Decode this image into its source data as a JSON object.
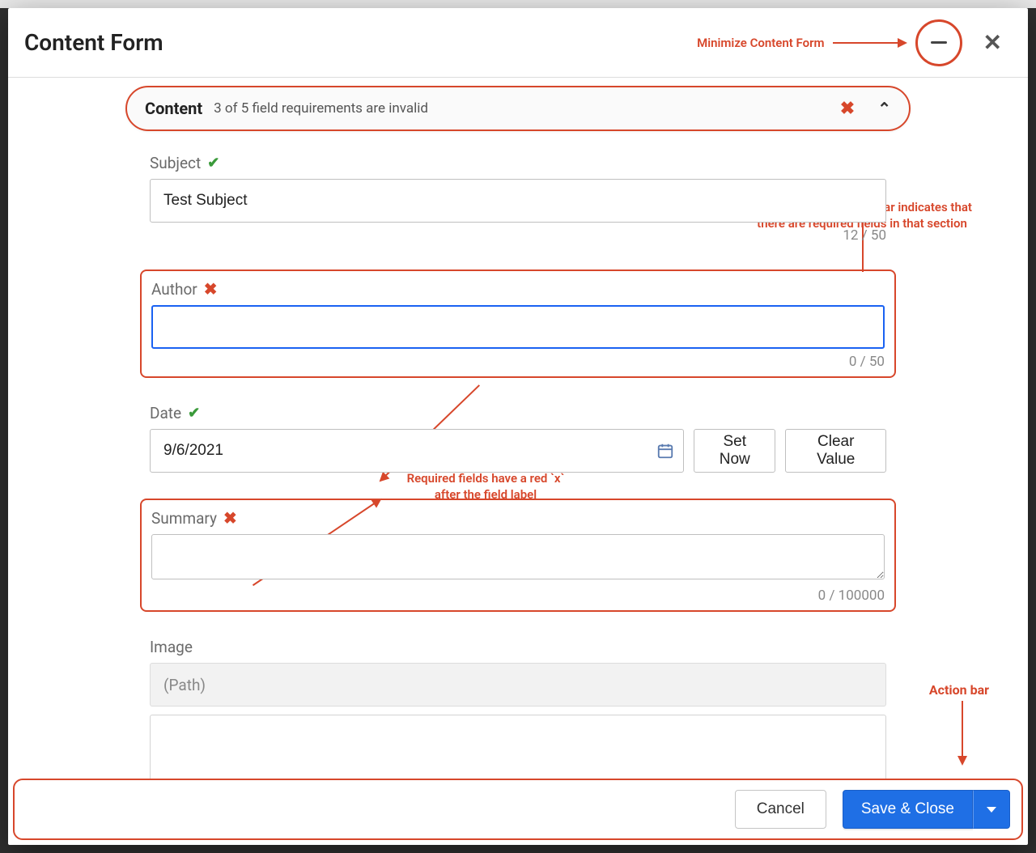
{
  "modal": {
    "title": "Content Form",
    "minimize_annotation": "Minimize Content Form",
    "minimize_icon": "minimize-icon",
    "close_icon": "close-icon"
  },
  "section": {
    "title": "Content",
    "status": "3 of 5 field requirements are invalid",
    "has_error": true,
    "annotation": "A red `x` in the section bar indicates that there are required fields in that section"
  },
  "fields": {
    "subject": {
      "label": "Subject",
      "valid": true,
      "value": "Test Subject",
      "counter": "12 / 50"
    },
    "author": {
      "label": "Author",
      "valid": false,
      "value": "",
      "counter": "0 / 50"
    },
    "date": {
      "label": "Date",
      "valid": true,
      "value": "9/6/2021",
      "set_now_label": "Set Now",
      "clear_label": "Clear Value"
    },
    "summary": {
      "label": "Summary",
      "valid": false,
      "value": "",
      "counter": "0 / 100000"
    },
    "image": {
      "label": "Image",
      "path_placeholder": "(Path)"
    }
  },
  "mid_annotation": {
    "line1": "Required fields have a red `x`",
    "line2": "after the field label"
  },
  "footer": {
    "cancel_label": "Cancel",
    "save_label": "Save & Close",
    "annotation": "Action bar"
  },
  "colors": {
    "accent_red": "#d7472b",
    "primary_blue": "#1f6fe5",
    "focus_blue": "#1a62f2",
    "valid_green": "#3a9a3a"
  }
}
